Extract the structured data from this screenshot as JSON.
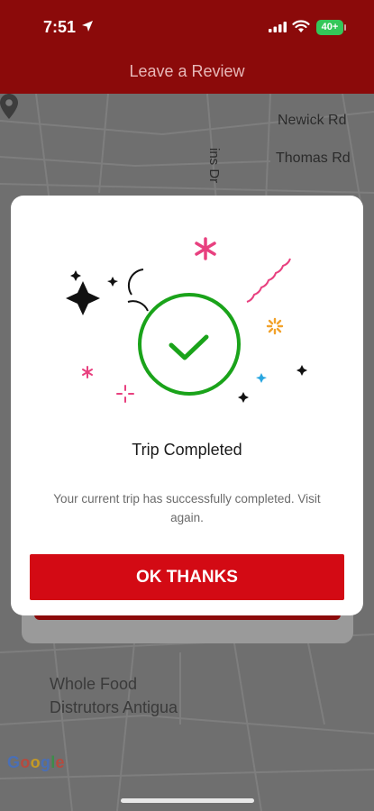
{
  "status_bar": {
    "time": "7:51",
    "battery": "40+"
  },
  "app_bar": {
    "title": "Leave a Review"
  },
  "map": {
    "labels": {
      "newick_rd": "Newick Rd",
      "thomas_rd": "Thomas Rd",
      "street_partial": "ins Dr"
    },
    "poi_name": "Whole Food\nDistrutors Antigua",
    "attribution": "Google"
  },
  "dialog": {
    "title": "Trip Completed",
    "message": "Your current trip has successfully completed. Visit again.",
    "ok_label": "OK THANKS"
  },
  "colors": {
    "brand_dark": "#8b0a0a",
    "button_red": "#d30a14",
    "success_green": "#1aa31a"
  }
}
